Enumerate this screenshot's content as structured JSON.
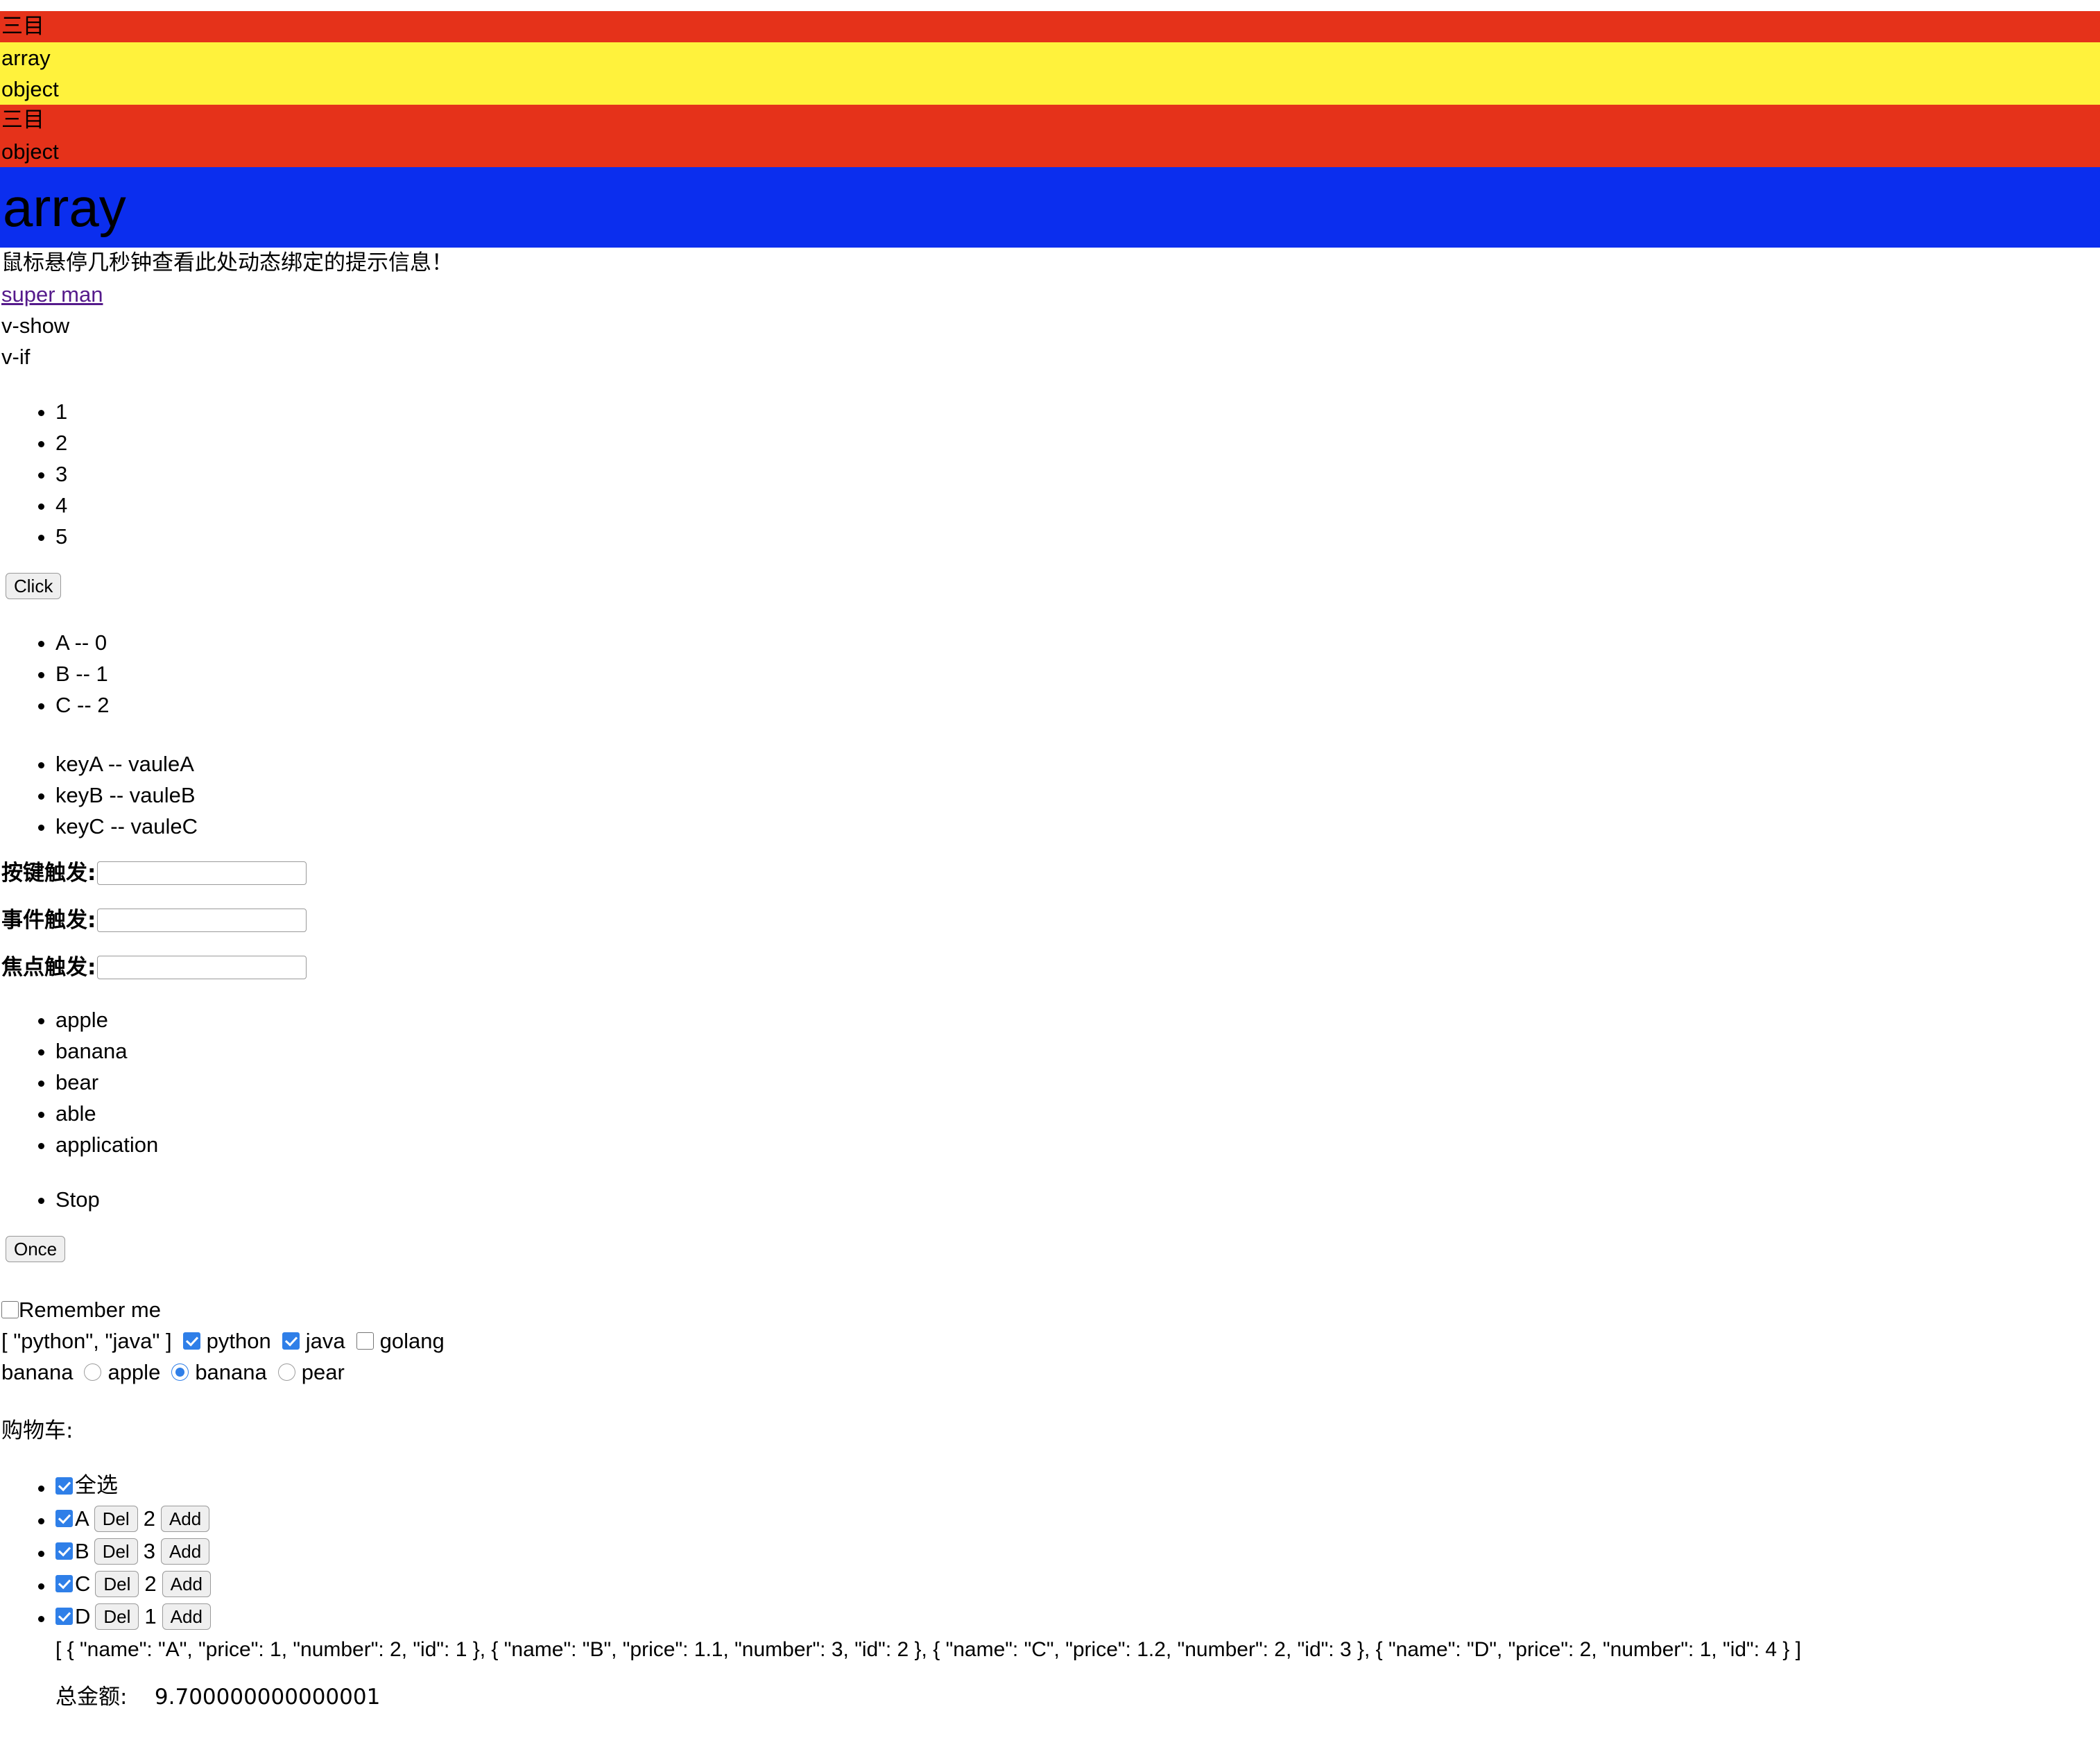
{
  "banners": {
    "block1": {
      "bg": "#e5321a",
      "line1": "三目"
    },
    "block2": {
      "bg": "#fff23c",
      "line1": "array",
      "line2": "object"
    },
    "block3": {
      "bg": "#e5321a",
      "line1": "三目",
      "line2": "object"
    },
    "block4": {
      "bg": "#0b2eee",
      "title": "array"
    }
  },
  "tooltip_text": "鼠标悬停几秒钟查看此处动态绑定的提示信息！",
  "link": {
    "label": "super man"
  },
  "directives": {
    "v_show": "v-show",
    "v_if": "v-if"
  },
  "number_list": [
    "1",
    "2",
    "3",
    "4",
    "5"
  ],
  "click_button": {
    "label": "Click"
  },
  "array_index_list": [
    "A -- 0",
    "B -- 1",
    "C -- 2"
  ],
  "object_key_list": [
    "keyA -- vauleA",
    "keyB -- vauleB",
    "keyC -- vauleC"
  ],
  "inputs": [
    {
      "label": "按键触发:",
      "value": "",
      "placeholder": ""
    },
    {
      "label": "事件触发:",
      "value": "",
      "placeholder": ""
    },
    {
      "label": "焦点触发:",
      "value": "",
      "placeholder": ""
    }
  ],
  "fruit_list": [
    "apple",
    "banana",
    "bear",
    "able",
    "application"
  ],
  "stop_list": [
    "Stop"
  ],
  "once_button": {
    "label": "Once"
  },
  "remember": {
    "label": "Remember me",
    "checked": false
  },
  "languages": {
    "selected_display": "[ \"python\", \"java\" ]",
    "options": [
      {
        "label": "python",
        "checked": true
      },
      {
        "label": "java",
        "checked": true
      },
      {
        "label": "golang",
        "checked": false
      }
    ]
  },
  "fruits_radio": {
    "selected_display": "banana",
    "options": [
      {
        "label": "apple",
        "checked": false
      },
      {
        "label": "banana",
        "checked": true
      },
      {
        "label": "pear",
        "checked": false
      }
    ]
  },
  "cart": {
    "title": "购物车:",
    "select_all": {
      "label": "全选",
      "checked": true
    },
    "del_label": "Del",
    "add_label": "Add",
    "items": [
      {
        "name": "A",
        "checked": true,
        "number": "2"
      },
      {
        "name": "B",
        "checked": true,
        "number": "3"
      },
      {
        "name": "C",
        "checked": true,
        "number": "2"
      },
      {
        "name": "D",
        "checked": true,
        "number": "1"
      }
    ],
    "json_dump": "[ { \"name\": \"A\", \"price\": 1, \"number\": 2, \"id\": 1 }, { \"name\": \"B\", \"price\": 1.1, \"number\": 3, \"id\": 2 }, { \"name\": \"C\", \"price\": 1.2, \"number\": 2, \"id\": 3 }, { \"name\": \"D\", \"price\": 2, \"number\": 1, \"id\": 4 } ]",
    "total_label": "总金额:",
    "total_value": "9.700000000000001"
  }
}
